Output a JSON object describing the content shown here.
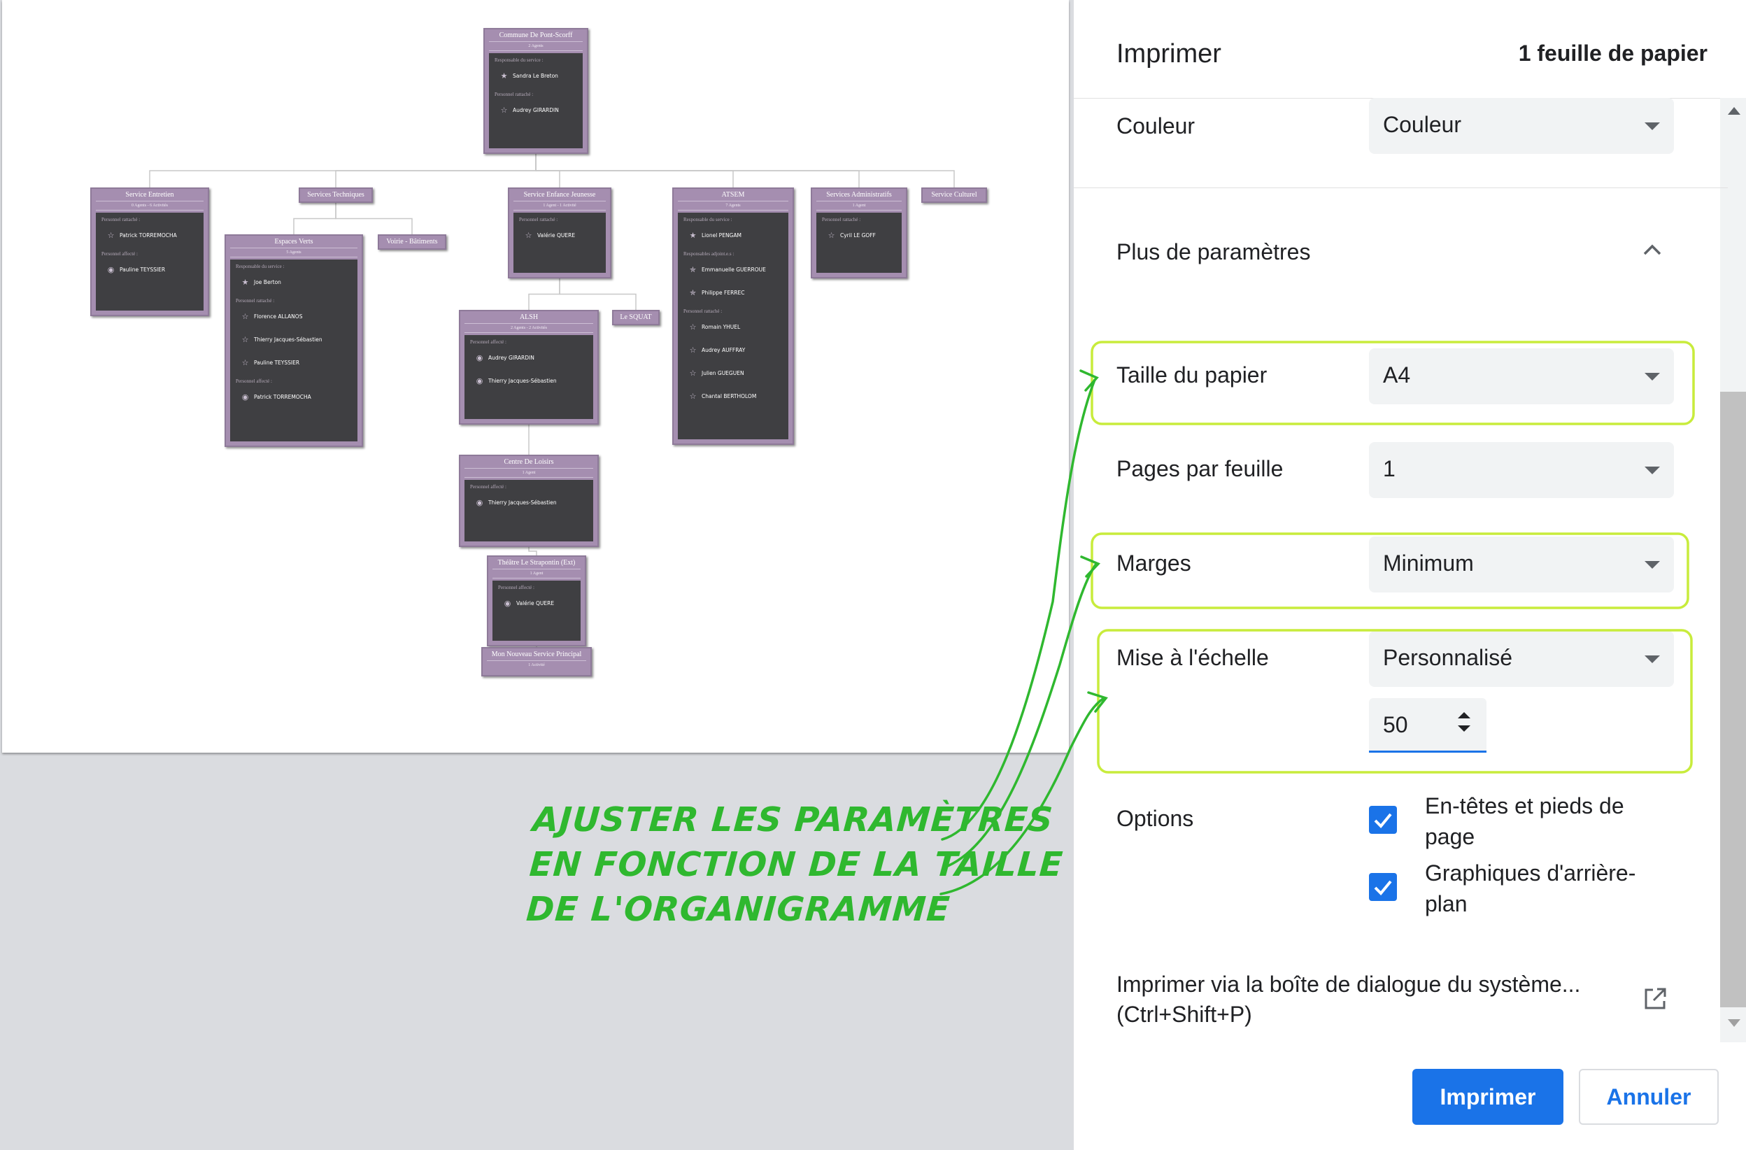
{
  "preview": {
    "org_nodes": [
      {
        "id": "commune",
        "title": "Commune De Pont-Scorff",
        "subtitle": "2 Agents",
        "sections": [
          {
            "label": "Responsable du service :",
            "people": [
              {
                "name": "Sandra Le Breton",
                "icon": "star-filled"
              }
            ]
          },
          {
            "label": "Personnel rattaché :",
            "people": [
              {
                "name": "Audrey GIRARDIN",
                "icon": "star-outline"
              }
            ]
          }
        ]
      },
      {
        "id": "service-entretien",
        "title": "Service Entretien",
        "subtitle": "0 Agents - 6 Activités",
        "sections": [
          {
            "label": "Personnel rattaché :",
            "people": [
              {
                "name": "Patrick TORREMOCHA",
                "icon": "star-outline"
              }
            ]
          },
          {
            "label": "Personnel affecté :",
            "people": [
              {
                "name": "Pauline TEYSSIER",
                "icon": "circle-icon"
              }
            ]
          }
        ]
      },
      {
        "id": "services-techniques",
        "title": "Services Techniques",
        "subtitle": "",
        "sections": []
      },
      {
        "id": "service-enfance",
        "title": "Service Enfance Jeunesse",
        "subtitle": "1 Agent - 1 Activité",
        "sections": [
          {
            "label": "Personnel rattaché :",
            "people": [
              {
                "name": "Valérie QUERE",
                "icon": "star-outline"
              }
            ]
          }
        ]
      },
      {
        "id": "atsem",
        "title": "ATSEM",
        "subtitle": "7 Agents",
        "sections": [
          {
            "label": "Responsable du service :",
            "people": [
              {
                "name": "Lionel PENGAM",
                "icon": "star-filled"
              }
            ]
          },
          {
            "label": "Responsables adjoint.e.s :",
            "people": [
              {
                "name": "Emmanuelle GUERROUE",
                "icon": "star-half"
              },
              {
                "name": "Philippe FERREC",
                "icon": "star-half"
              }
            ]
          },
          {
            "label": "Personnel rattaché :",
            "people": [
              {
                "name": "Romain YHUEL",
                "icon": "star-outline"
              },
              {
                "name": "Audrey AUFFRAY",
                "icon": "star-outline"
              },
              {
                "name": "Julien GUEGUEN",
                "icon": "star-outline"
              },
              {
                "name": "Chantal BERTHOLOM",
                "icon": "star-outline"
              }
            ]
          }
        ]
      },
      {
        "id": "services-administratifs",
        "title": "Services Administratifs",
        "subtitle": "1 Agent",
        "sections": [
          {
            "label": "Personnel rattaché :",
            "people": [
              {
                "name": "Cyril LE GOFF",
                "icon": "star-outline"
              }
            ]
          }
        ]
      },
      {
        "id": "service-culturel",
        "title": "Service Culturel",
        "subtitle": "",
        "sections": []
      },
      {
        "id": "espaces-verts",
        "title": "Espaces Verts",
        "subtitle": "5 Agents",
        "sections": [
          {
            "label": "Responsable du service :",
            "people": [
              {
                "name": "Joe Berton",
                "icon": "star-filled"
              }
            ]
          },
          {
            "label": "Personnel rattaché :",
            "people": [
              {
                "name": "Florence ALLANOS",
                "icon": "star-outline"
              },
              {
                "name": "Thierry Jacques-Sébastien",
                "icon": "star-outline"
              },
              {
                "name": "Pauline TEYSSIER",
                "icon": "star-outline"
              }
            ]
          },
          {
            "label": "Personnel affecté :",
            "people": [
              {
                "name": "Patrick TORREMOCHA",
                "icon": "circle-icon"
              }
            ]
          }
        ]
      },
      {
        "id": "voirie",
        "title": "Voirie - Bâtiments",
        "subtitle": "",
        "sections": []
      },
      {
        "id": "alsh",
        "title": "ALSH",
        "subtitle": "2 Agents - 2 Activités",
        "sections": [
          {
            "label": "Personnel affecté :",
            "people": [
              {
                "name": "Audrey GIRARDIN",
                "icon": "circle-icon"
              },
              {
                "name": "Thierry Jacques-Sébastien",
                "icon": "circle-icon"
              }
            ]
          }
        ]
      },
      {
        "id": "le-squat",
        "title": "Le SQUAT",
        "subtitle": "",
        "sections": []
      },
      {
        "id": "centre-loisirs",
        "title": "Centre De Loisirs",
        "subtitle": "1 Agent",
        "sections": [
          {
            "label": "Personnel affecté :",
            "people": [
              {
                "name": "Thierry Jacques-Sébastien",
                "icon": "circle-icon"
              }
            ]
          }
        ]
      },
      {
        "id": "theatre",
        "title": "Théâtre Le Strapontin (Ext)",
        "subtitle": "1 Agent",
        "sections": [
          {
            "label": "Personnel affecté :",
            "people": [
              {
                "name": "Valérie QUERE",
                "icon": "circle-icon"
              }
            ]
          }
        ]
      },
      {
        "id": "nouveau-service",
        "title": "Mon Nouveau Service Principal",
        "subtitle": "1 Activité",
        "sections": []
      }
    ]
  },
  "annotation": {
    "lines": [
      "AJUSTER LES PARAMÈTRES",
      "EN FONCTION DE LA TAILLE",
      "DE L'ORGANIGRAMME"
    ],
    "color": "#2fb82f"
  },
  "panel": {
    "title": "Imprimer",
    "sheet_count": "1 feuille de papier",
    "color_label": "Couleur",
    "color_value": "Couleur",
    "more_settings_label": "Plus de paramètres",
    "paper_size_label": "Taille du papier",
    "paper_size_value": "A4",
    "pages_per_sheet_label": "Pages par feuille",
    "pages_per_sheet_value": "1",
    "margins_label": "Marges",
    "margins_value": "Minimum",
    "scale_label": "Mise à l'échelle",
    "scale_value": "Personnalisé",
    "scale_number": "50",
    "options_label": "Options",
    "option_headers": "En-têtes et pieds de page",
    "option_headers_checked": true,
    "option_backgrounds": "Graphiques d'arrière-plan",
    "option_backgrounds_checked": true,
    "system_dialog": "Imprimer via la boîte de dialogue du système... (Ctrl+Shift+P)",
    "print_button": "Imprimer",
    "cancel_button": "Annuler",
    "accent_color": "#1a73e8",
    "highlight_color": "#c8ec3c"
  }
}
